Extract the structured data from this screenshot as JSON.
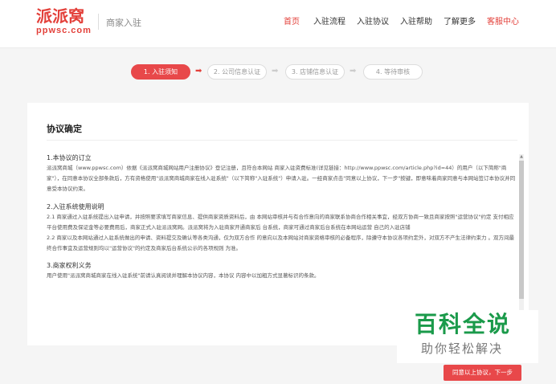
{
  "header": {
    "logo_main": "派派窝",
    "logo_sub": "ppwsc.com",
    "page_name": "商家入驻",
    "nav": [
      {
        "label": "首页",
        "active": true
      },
      {
        "label": "入驻流程",
        "active": false
      },
      {
        "label": "入驻协议",
        "active": false
      },
      {
        "label": "入驻帮助",
        "active": false
      },
      {
        "label": "了解更多",
        "active": false
      },
      {
        "label": "客服中心",
        "active": true
      }
    ]
  },
  "steps": [
    {
      "label": "1. 入驻须知",
      "active": true
    },
    {
      "label": "2. 公司信息认证",
      "active": false
    },
    {
      "label": "3. 店铺信息认证",
      "active": false
    },
    {
      "label": "4. 等待审核",
      "active": false
    }
  ],
  "arrow_glyph": "➡",
  "panel": {
    "title": "协议确定",
    "sections": [
      {
        "title": "1.本协议的订立",
        "body": "派派窝商城（www.ppwsc.com）依据《派派窝商城网站用户注册协议》登记注册，且符合本网站 商家入驻资费标准(详见链接：http://www.ppwsc.com/article.php?id=44）的用户（以下简称\"商 家\"），在同意本协议全部条款后，方有资格使用\"派派窝商城商家在线入驻系统\"（以下简称\"入驻系统\"）申请入驻。一经商家点击\"同意以上协议，下一步\"按键，即意味着商家同意与本网站签订本协议并同意受本协议约束。"
      },
      {
        "title": "2.入驻系统使用说明",
        "body": "2.1 商家通过入驻系统提出入驻申请，并按照要求填写商家信息、提供商家资质资料后，由 本网站审核并与有合作意向的商家联系协商合作相关事宜，经双方协商一致且商家按照\"运营协议\"约定 支付相应平台使用费及保证金等必要费用后，商家正式入驻派派窝网。派派窝将为入驻商家开通商家后 台系统，商家可通过商家后台系统在本网站运营 自己的入驻店铺\n2.2 商家以及本网站通过入驻系统做出的申请、资料提交及确认等各类沟通，仅为双方合作 的意向以及本网站对商家资格审核的必备程序，除遵守本协议各项约定外，对双方不产生法律约束力 。双方间最终合作事宜及运营规则均以\"运营协议\"的约定及商家后台系统公示的各项规则 为准。"
      },
      {
        "title": "3.商家权利义务",
        "body": "用户使用\"派派窝商城商家在线入驻系统\"前请认真阅读并理解本协议内容，本协议 内容中以加粗方式显著标识的条款。"
      }
    ],
    "scroll_up_glyph": "▲"
  },
  "watermark": {
    "main": "百科全说",
    "sub": "助你轻松解决"
  },
  "agree_button": "同意以上协议，下一步",
  "colors": {
    "accent": "#e3403a",
    "step_active": "#e8484a",
    "watermark_green": "#1a9a4a"
  }
}
